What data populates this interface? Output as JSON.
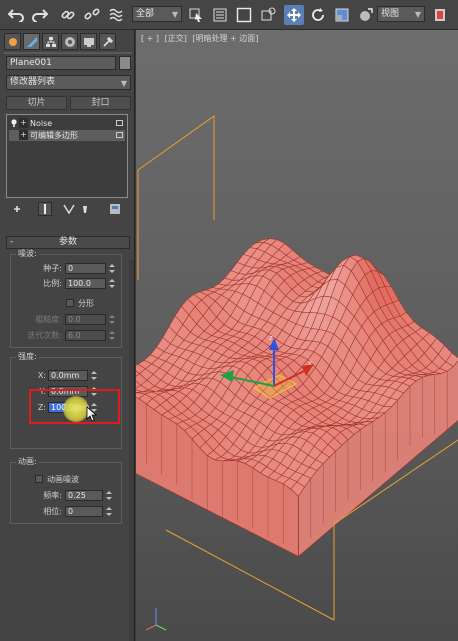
{
  "toolbar": {
    "selection_filter": "全部",
    "ref_coord": "视图"
  },
  "panel": {
    "object_name": "Plane001",
    "modifier_list": "修改器列表",
    "btn_slice": "切片",
    "btn_cap": "封口",
    "stack": [
      {
        "label": "Noise"
      },
      {
        "label": "可编辑多边形"
      }
    ],
    "rollout_title": "参数",
    "noise": {
      "title": "噪波:",
      "seed_label": "种子:",
      "seed": "0",
      "scale_label": "比例:",
      "scale": "100.0",
      "fractal_label": "分形",
      "roughness_label": "粗糙度:",
      "roughness": "0.0",
      "iterations_label": "迭代次数:",
      "iterations": "6.0"
    },
    "strength": {
      "title": "强度:",
      "x_label": "X:",
      "x": "0.0mm",
      "y_label": "Y:",
      "y": "0.0mm",
      "z_label": "Z:",
      "z": "100.0mm"
    },
    "animation": {
      "title": "动画:",
      "animate_label": "动画噪波",
      "freq_label": "频率:",
      "freq": "0.25",
      "phase_label": "相位:",
      "phase": "0"
    }
  },
  "viewport": {
    "label_plus": "[ + ]",
    "label_view": "[正交]",
    "label_shading": "[明暗处理 + 边面]"
  },
  "colors": {
    "mesh_fill": "#e8857a",
    "mesh_wire": "#a3322c",
    "bbox": "#e8a030",
    "highlight_box": "#e01b1b"
  }
}
